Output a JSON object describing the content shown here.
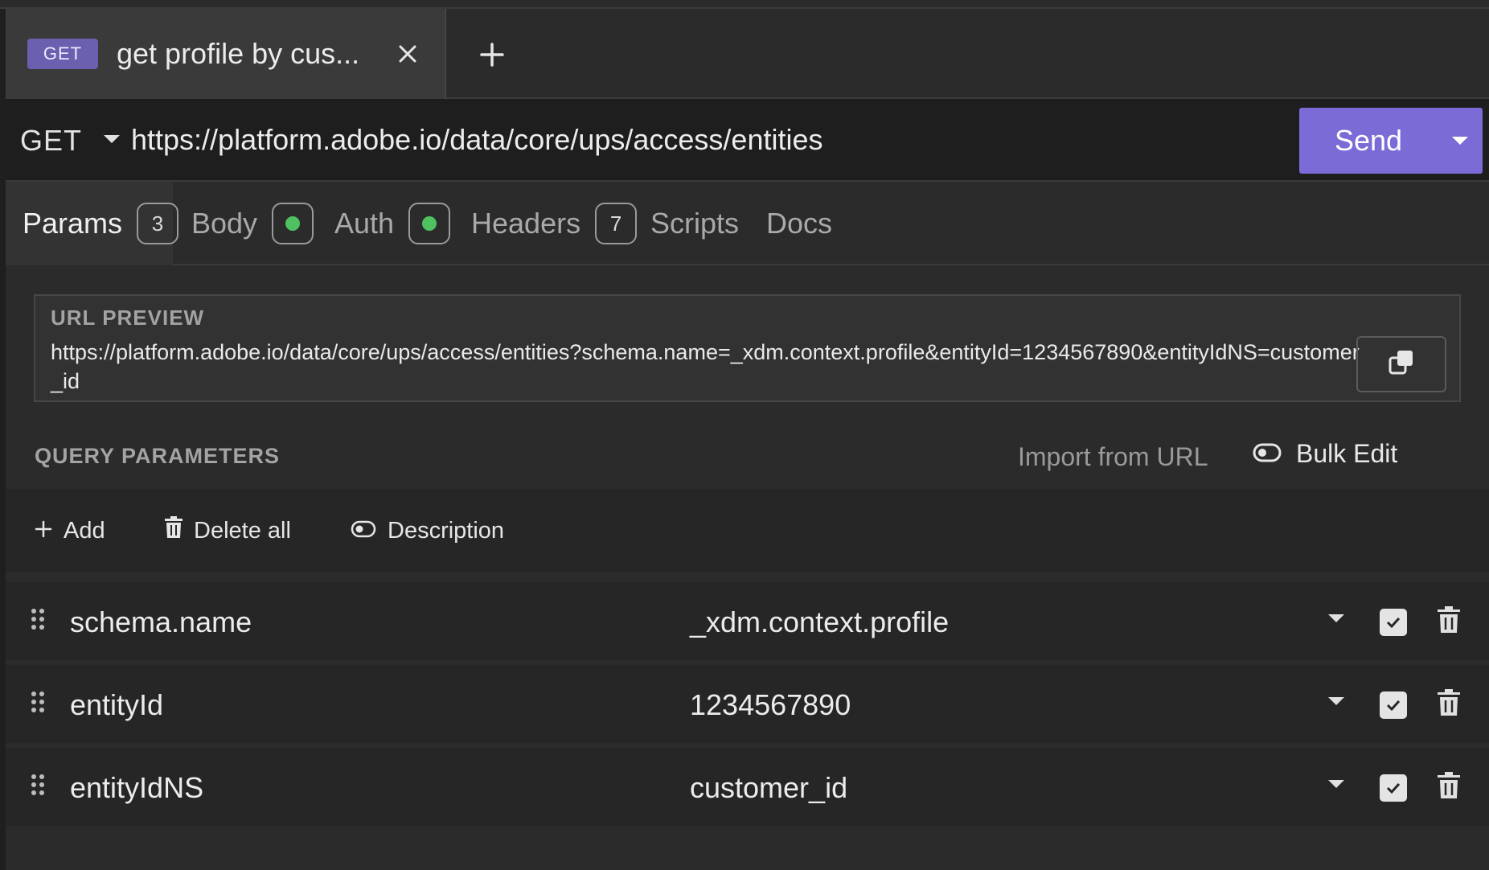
{
  "tab": {
    "method": "GET",
    "title": "get profile by cus..."
  },
  "request": {
    "method": "GET",
    "url": "https://platform.adobe.io/data/core/ups/access/entities",
    "send_label": "Send"
  },
  "request_tabs": [
    {
      "label": "Params",
      "badge": "3"
    },
    {
      "label": "Body"
    },
    {
      "label": "Auth"
    },
    {
      "label": "Headers",
      "badge": "7"
    },
    {
      "label": "Scripts"
    },
    {
      "label": "Docs"
    }
  ],
  "preview": {
    "label": "URL PREVIEW",
    "url": "https://platform.adobe.io/data/core/ups/access/entities?schema.name=_xdm.context.profile&entityId=1234567890&entityIdNS=customer_id"
  },
  "query_params": {
    "header": "QUERY PARAMETERS",
    "import_label": "Import from URL",
    "bulk_edit_label": "Bulk Edit",
    "add_label": "Add",
    "delete_all_label": "Delete all",
    "description_label": "Description",
    "rows": [
      {
        "key": "schema.name",
        "value": "_xdm.context.profile",
        "enabled": true
      },
      {
        "key": "entityId",
        "value": "1234567890",
        "enabled": true
      },
      {
        "key": "entityIdNS",
        "value": "customer_id",
        "enabled": true
      }
    ]
  },
  "colors": {
    "accent": "#7b6bd6",
    "method_badge": "#6b5fb0",
    "status_dot": "#4fc160",
    "background": "#2b2b2b"
  },
  "icons": {
    "tab_close": "close-icon",
    "new_tab": "plus-icon",
    "copy": "copy-icon",
    "add": "plus-icon",
    "delete_all": "trash-icon",
    "toggle": "toggle-icon",
    "drag": "drag-handle-icon",
    "caret": "caret-down-icon",
    "check": "checkbox-icon",
    "row_delete": "trash-icon"
  }
}
